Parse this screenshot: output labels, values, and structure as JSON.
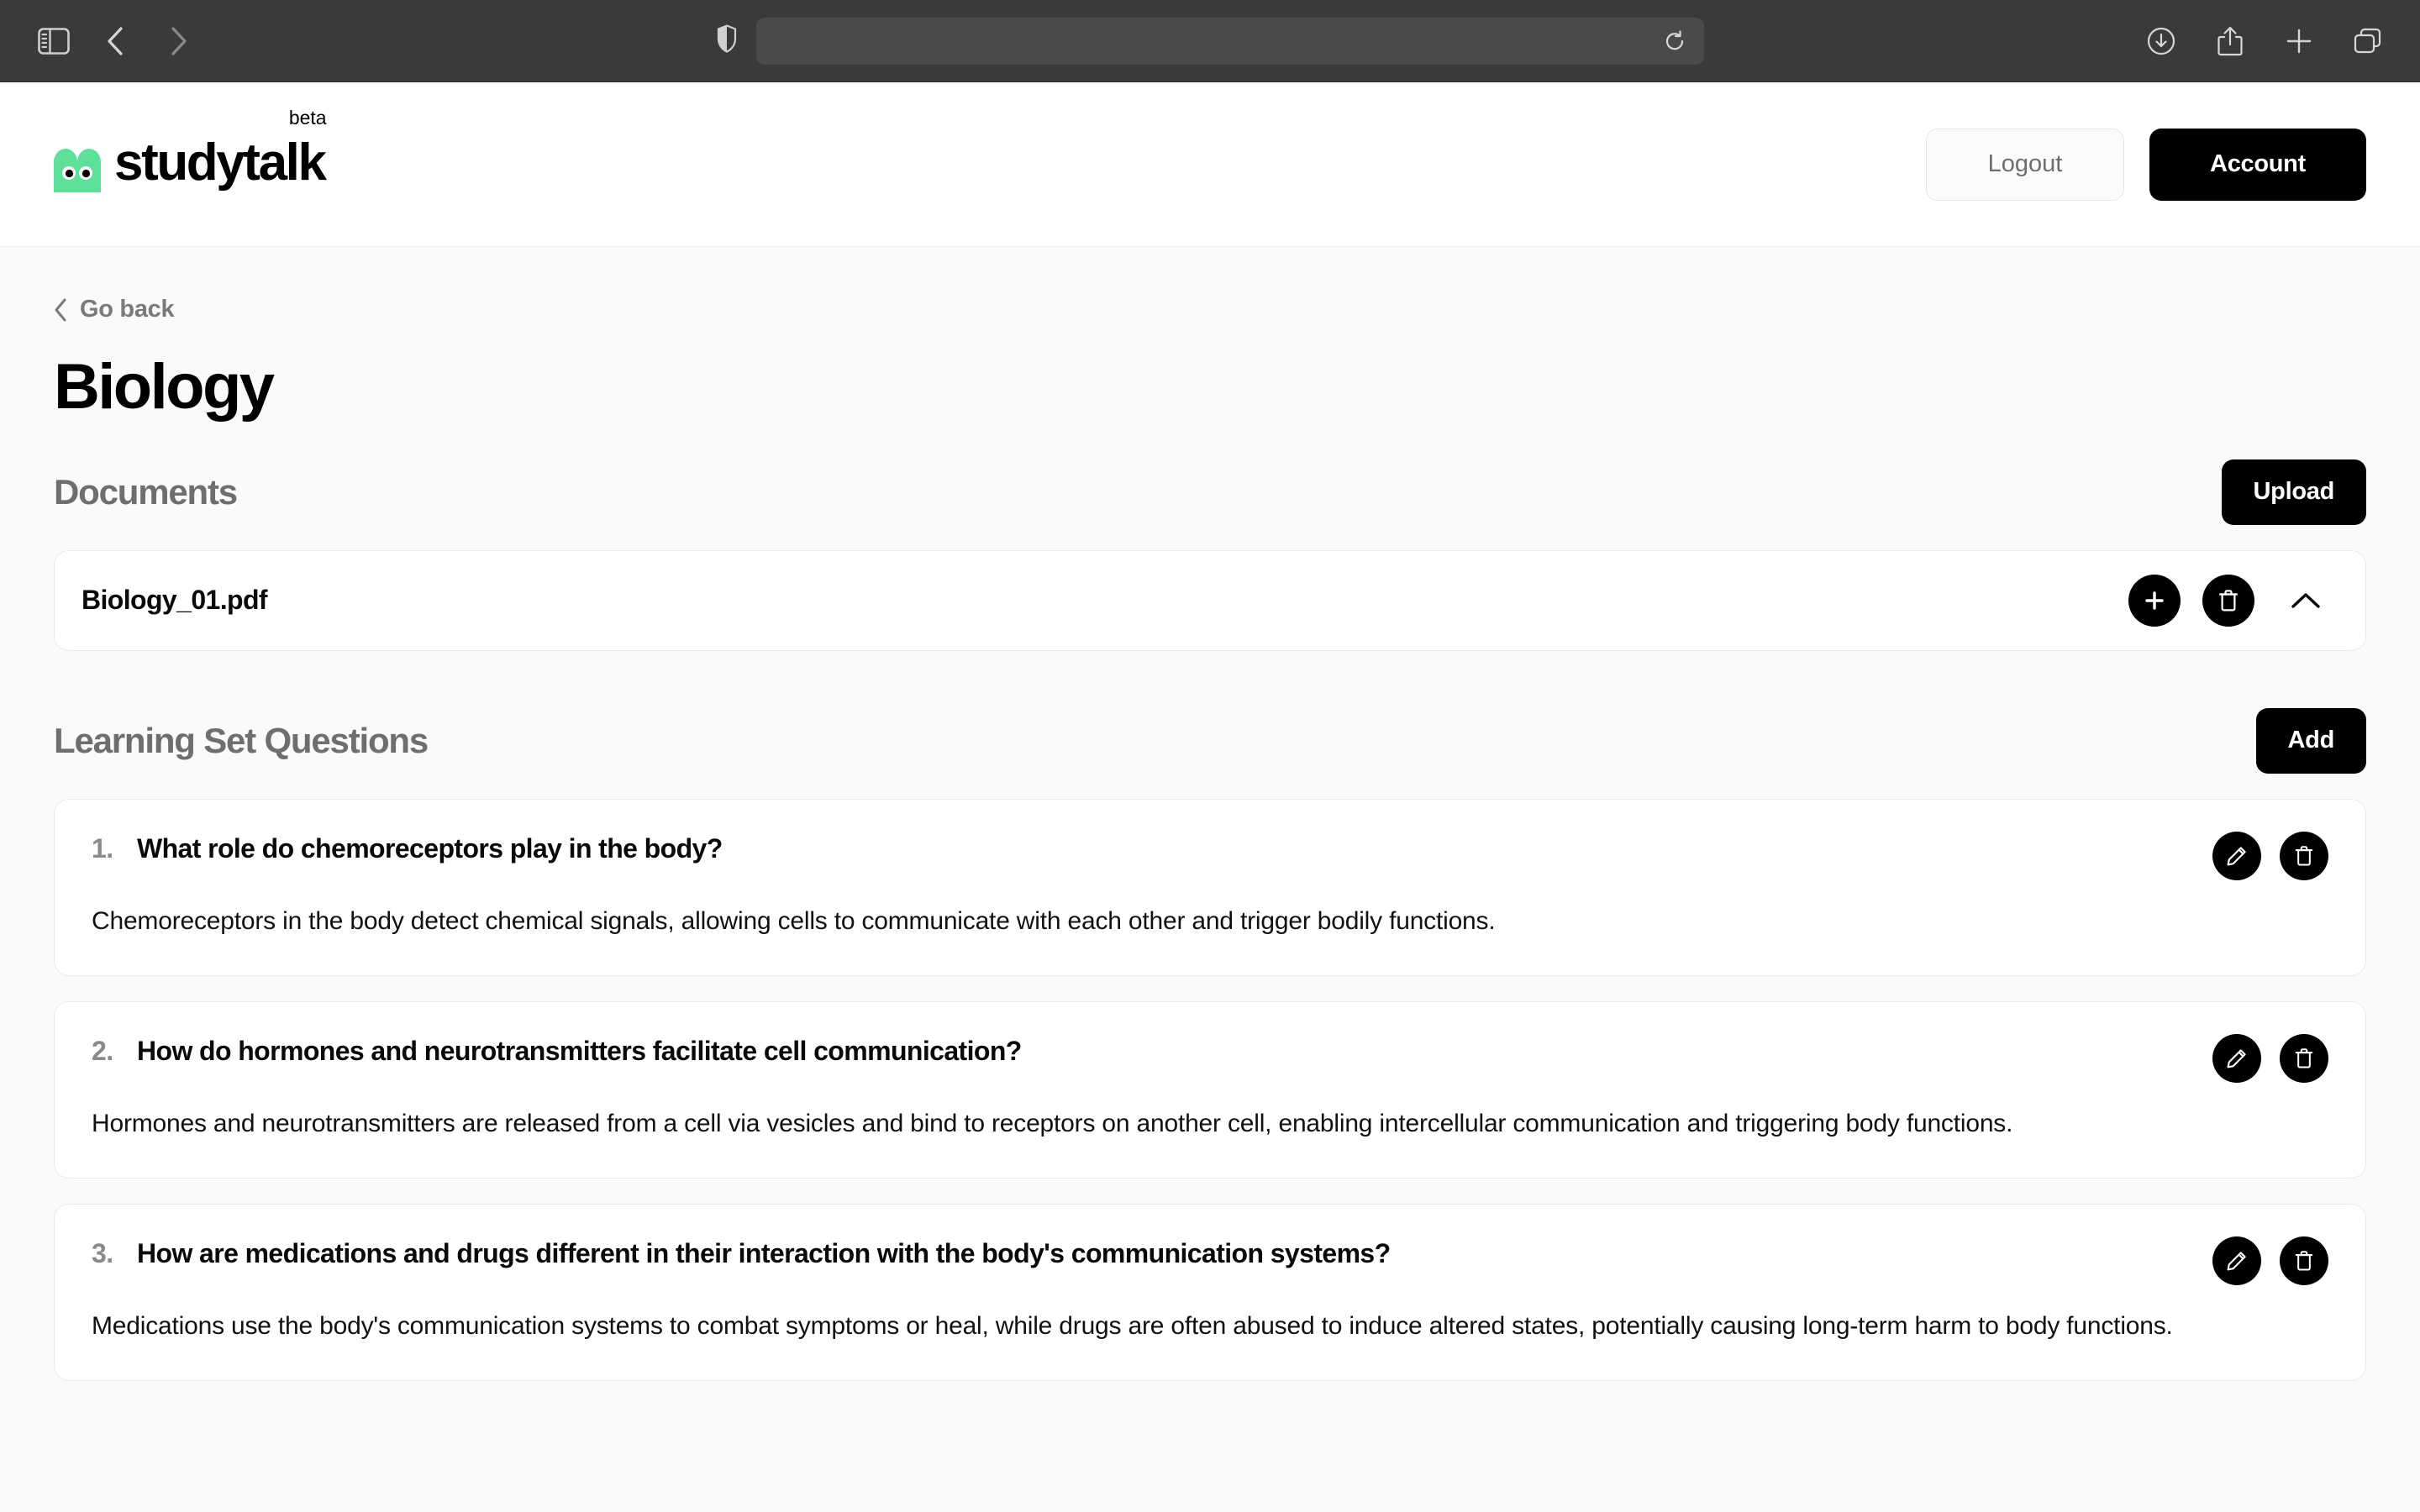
{
  "browser": {
    "sidebar_toggle": "sidebar-toggle",
    "back": "back",
    "forward": "forward",
    "shield": "privacy-shield",
    "address_value": "",
    "address_placeholder": "",
    "reload": "reload",
    "downloads": "downloads",
    "share": "share",
    "new_tab": "new-tab",
    "tab_overview": "tab-overview"
  },
  "header": {
    "logo_text": "studytalk",
    "logo_badge": "beta",
    "logout_label": "Logout",
    "account_label": "Account"
  },
  "nav": {
    "go_back_label": "Go back"
  },
  "page": {
    "title": "Biology"
  },
  "documents": {
    "section_title": "Documents",
    "upload_label": "Upload",
    "items": [
      {
        "name": "Biology_01.pdf",
        "add_label": "add",
        "delete_label": "delete",
        "collapse_label": "collapse"
      }
    ]
  },
  "learning_set": {
    "section_title": "Learning Set Questions",
    "add_label": "Add",
    "questions": [
      {
        "num": "1.",
        "question": "What role do chemoreceptors play in the body?",
        "answer": "Chemoreceptors in the body detect chemical signals, allowing cells to communicate with each other and trigger bodily functions."
      },
      {
        "num": "2.",
        "question": "How do hormones and neurotransmitters facilitate cell communication?",
        "answer": "Hormones and neurotransmitters are released from a cell via vesicles and bind to receptors on another cell, enabling intercellular communication and triggering body functions."
      },
      {
        "num": "3.",
        "question": "How are medications and drugs different in their interaction with the body's communication systems?",
        "answer": "Medications use the body's communication systems to combat symptoms or heal, while drugs are often abused to induce altered states, potentially causing long-term harm to body functions."
      }
    ]
  },
  "colors": {
    "brand_green": "#5fe09a",
    "accent_black": "#000000",
    "page_bg": "#fafafa",
    "card_bg": "#ffffff",
    "card_border": "#eaeaea",
    "muted_text": "#6e6e6e",
    "chrome_bg": "#3a3a3a"
  }
}
